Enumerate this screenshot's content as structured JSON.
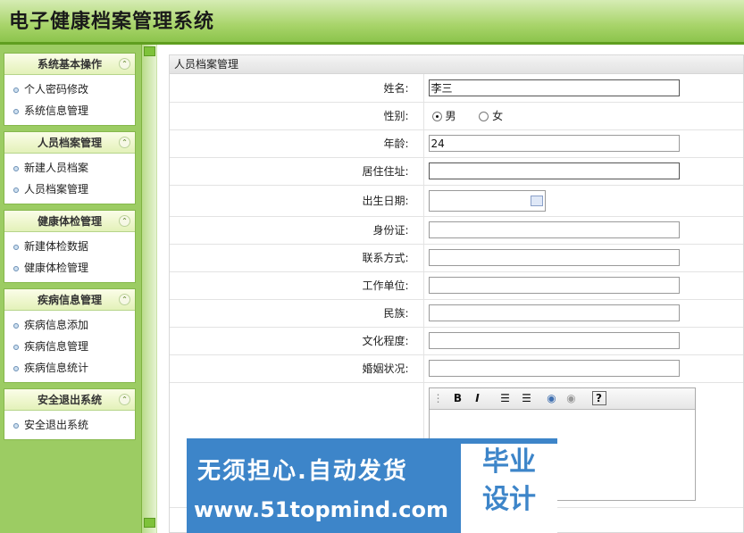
{
  "app": {
    "title": "电子健康档案管理系统"
  },
  "sidebar": {
    "groups": [
      {
        "title": "系统基本操作",
        "items": [
          "个人密码修改",
          "系统信息管理"
        ]
      },
      {
        "title": "人员档案管理",
        "items": [
          "新建人员档案",
          "人员档案管理"
        ]
      },
      {
        "title": "健康体检管理",
        "items": [
          "新建体检数据",
          "健康体检管理"
        ]
      },
      {
        "title": "疾病信息管理",
        "items": [
          "疾病信息添加",
          "疾病信息管理",
          "疾病信息统计"
        ]
      },
      {
        "title": "安全退出系统",
        "items": [
          "安全退出系统"
        ]
      }
    ]
  },
  "panel": {
    "title": "人员档案管理",
    "fields": {
      "name": {
        "label": "姓名:",
        "value": "李三"
      },
      "gender": {
        "label": "性别:",
        "options": [
          "男",
          "女"
        ],
        "selected": "男"
      },
      "age": {
        "label": "年龄:",
        "value": "24"
      },
      "address": {
        "label": "居住住址:",
        "value": ""
      },
      "birthdate": {
        "label": "出生日期:",
        "value": ""
      },
      "idcard": {
        "label": "身份证:",
        "value": ""
      },
      "contact": {
        "label": "联系方式:",
        "value": ""
      },
      "workplace": {
        "label": "工作单位:",
        "value": ""
      },
      "ethnicity": {
        "label": "民族:",
        "value": ""
      },
      "education": {
        "label": "文化程度:",
        "value": ""
      },
      "marital": {
        "label": "婚姻状况:",
        "value": ""
      }
    },
    "editor": {
      "toolbar": {
        "bold": "B",
        "italic": "I",
        "help": "?"
      }
    }
  },
  "watermark": {
    "line1": "无须担心.自动发货",
    "line2": "www.51topmind.com",
    "box1": "毕业",
    "box2": "设计"
  }
}
